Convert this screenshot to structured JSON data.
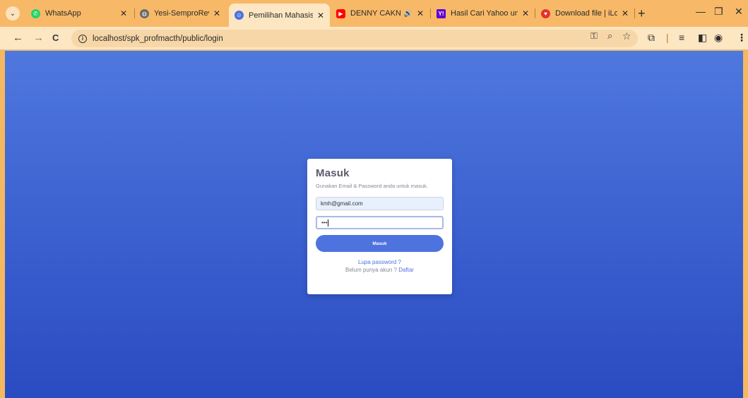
{
  "browser": {
    "tabs": [
      {
        "title": "WhatsApp",
        "favicon_color": "#25d366",
        "active": false
      },
      {
        "title": "Yesi-SemproRevisirev",
        "favicon_color": "#6b6b6b",
        "active": false
      },
      {
        "title": "Pemilihan Mahasiswa",
        "favicon_color": "#4e73df",
        "active": true
      },
      {
        "title": "DENNY CAKNAN",
        "favicon_color": "#ff0000",
        "active": false,
        "audio": "🔊"
      },
      {
        "title": "Hasil Cari Yahoo untu",
        "favicon_color": "#6001d2",
        "active": false
      },
      {
        "title": "Download file | iLove",
        "favicon_color": "#e5322d",
        "active": false
      }
    ],
    "tab_close_glyph": "✕",
    "new_tab_glyph": "+",
    "window_controls": {
      "minimize": "—",
      "restore": "❐",
      "close": "✕"
    },
    "toolbar": {
      "back": "←",
      "forward": "→",
      "reload": "C",
      "url": "localhost/spk_profmacth/public/login",
      "icons": [
        "key-icon",
        "zoom-icon",
        "star-icon",
        "extensions-icon",
        "media-icon",
        "sidepanel-icon",
        "profile-icon",
        "menu-icon"
      ]
    }
  },
  "login": {
    "title": "Masuk",
    "subtitle": "Gunakan Email & Password anda untuk masuk.",
    "email_value": "kmh@gmail.com",
    "password_value": "•••",
    "submit_label": "Masuk",
    "forgot_label": "Lupa password ?",
    "register_prefix": "Belum punya akun ?",
    "register_label": "Daftar"
  },
  "colors": {
    "tabstrip": "#f7b968",
    "toolbar": "#fde6c2",
    "page_gradient_top": "#4f78de",
    "page_gradient_bottom": "#2a4bc1",
    "primary": "#4e73df"
  }
}
